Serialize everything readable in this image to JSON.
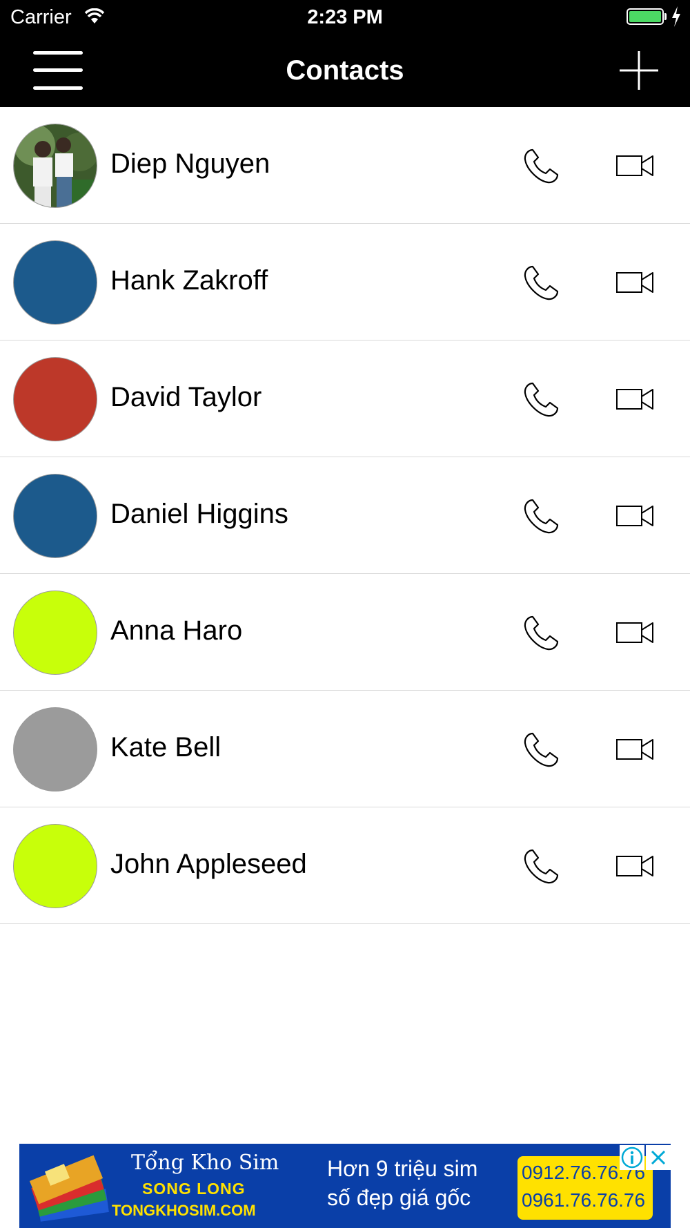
{
  "status_bar": {
    "carrier": "Carrier",
    "time": "2:23 PM",
    "battery_color": "#4cd964"
  },
  "nav": {
    "title": "Contacts",
    "menu_icon": "hamburger-icon",
    "add_icon": "plus-icon"
  },
  "contacts": [
    {
      "name": "Diep Nguyen",
      "avatar": "photo",
      "avatar_color": "#5a7a45"
    },
    {
      "name": "Hank Zakroff",
      "avatar": "color",
      "avatar_color": "#1c5a8c"
    },
    {
      "name": "David Taylor",
      "avatar": "color",
      "avatar_color": "#bd3829"
    },
    {
      "name": "Daniel Higgins",
      "avatar": "color",
      "avatar_color": "#1c5a8c"
    },
    {
      "name": "Anna Haro",
      "avatar": "color",
      "avatar_color": "#c8ff0a"
    },
    {
      "name": "Kate Bell",
      "avatar": "color",
      "avatar_color": "#9b9b9b"
    },
    {
      "name": "John Appleseed",
      "avatar": "color",
      "avatar_color": "#c8ff0a"
    }
  ],
  "row_actions": {
    "call_icon": "phone-icon",
    "video_icon": "video-camera-icon"
  },
  "ad": {
    "brand_top": "Tổng Kho Sim",
    "brand_mid": "SONG LONG",
    "brand_url": "TONGKHOSIM.COM",
    "slogan_line1": "Hơn 9 triệu sim",
    "slogan_line2": "số đẹp giá gốc",
    "phone1": "0912.76.76.76",
    "phone2": "0961.76.76.76",
    "background_color": "#0a3fa8",
    "accent_color": "#ffe100"
  }
}
